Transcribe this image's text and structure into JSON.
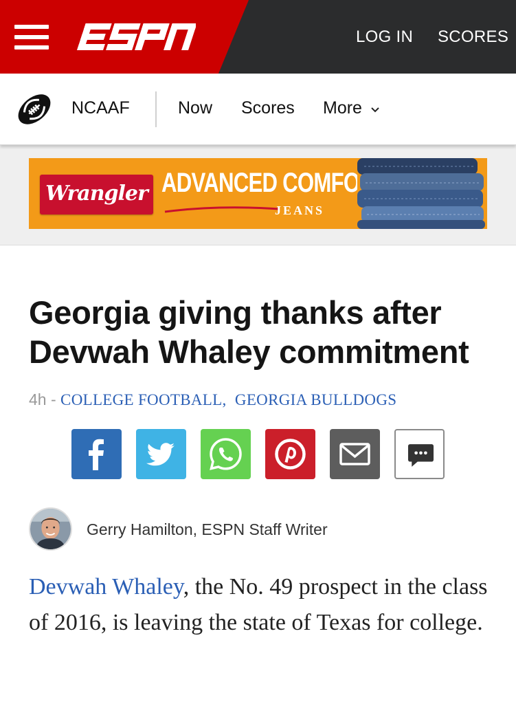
{
  "header": {
    "logo_text": "ESPN",
    "login_label": "LOG IN",
    "scores_label": "SCORES",
    "menu_icon": "hamburger-menu-icon"
  },
  "subnav": {
    "sport_icon": "football-icon",
    "sport_label": "NCAAF",
    "items": [
      {
        "label": "Now"
      },
      {
        "label": "Scores"
      },
      {
        "label": "More"
      }
    ],
    "more_icon": "chevron-down-icon"
  },
  "ad": {
    "brand": "Wrangler",
    "headline": "ADVANCED COMFORT",
    "trademark": "™",
    "subline": "JEANS",
    "colors": {
      "background": "#f39a18",
      "brand": "#c8102e"
    }
  },
  "article": {
    "headline": "Georgia giving thanks after Devwah Whaley commitment",
    "time": "4h",
    "separator": "-",
    "tags": [
      "COLLEGE FOOTBALL,",
      "GEORGIA BULLDOGS"
    ],
    "share_buttons": [
      {
        "name": "facebook",
        "icon": "facebook-icon",
        "color": "#2f6db5"
      },
      {
        "name": "twitter",
        "icon": "twitter-icon",
        "color": "#3fb3e5"
      },
      {
        "name": "whatsapp",
        "icon": "whatsapp-icon",
        "color": "#65d151"
      },
      {
        "name": "pinterest",
        "icon": "pinterest-icon",
        "color": "#cb1f2a"
      },
      {
        "name": "email",
        "icon": "email-icon",
        "color": "#5d5d5d"
      },
      {
        "name": "comments",
        "icon": "comment-icon",
        "color": "#ffffff"
      }
    ],
    "byline": "Gerry Hamilton, ESPN Staff Writer",
    "body_link": "Devwah Whaley",
    "body_rest": ", the No. 49 prospect in the class of 2016, is leaving the state of Texas for college."
  },
  "colors": {
    "espn_red": "#cc0000",
    "header_dark": "#2b2c2d",
    "link_blue": "#2b5fb5"
  }
}
